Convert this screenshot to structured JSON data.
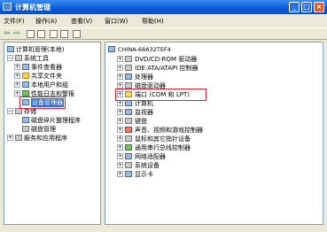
{
  "window": {
    "title": "计算机管理",
    "controls": {
      "minimize": "_",
      "maximize": "□",
      "close": "×"
    }
  },
  "menu": {
    "file": "文件(F)",
    "action": "操作(A)",
    "view": "查看(V)",
    "window": "窗口(W)",
    "help": "帮助(H)"
  },
  "toolbar": {
    "back": "⇦",
    "forward": "⇨"
  },
  "left_tree": {
    "root": "计算机管理(本地)",
    "system_tools": "系统工具",
    "event_viewer": "事件查看器",
    "shared_folders": "共享文件夹",
    "local_users": "本地用户和组",
    "perf_logs": "性能日志和警报",
    "device_manager": "设备管理器",
    "storage": "存储",
    "defrag": "磁盘碎片整理程序",
    "disk_management": "磁盘管理",
    "services_apps": "服务和应用程序"
  },
  "right_tree": {
    "computer": "CHINA-68A32TEF4",
    "items": [
      "DVD/CD-ROM 驱动器",
      "IDE ATA/ATAPI 控制器",
      "处理器",
      "磁盘驱动器",
      "端口 (COM 和 LPT)",
      "计算机",
      "监视器",
      "键盘",
      "声音、视频和游戏控制器",
      "鼠标和其它指针设备",
      "通用串行总线控制器",
      "网络适配器",
      "系统设备",
      "显示卡"
    ]
  }
}
